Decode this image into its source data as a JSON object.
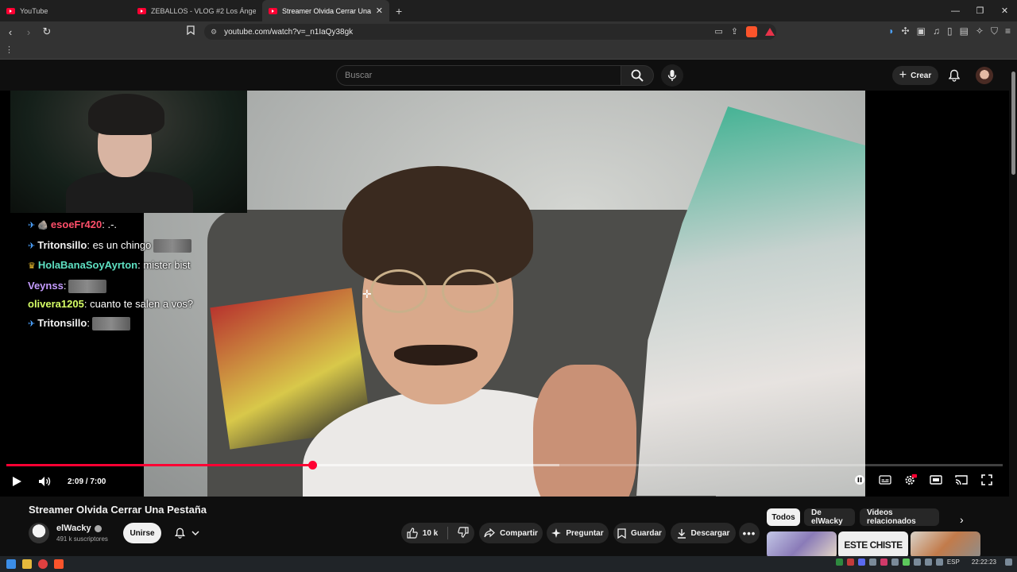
{
  "browser": {
    "tabs": [
      {
        "title": "YouTube",
        "active": false
      },
      {
        "title": "ZEBALLOS - VLOG #2 Los Ángeles | A",
        "active": false
      },
      {
        "title": "Streamer Olvida Cerrar Una Pestañ",
        "active": true
      }
    ],
    "url": "youtube.com/watch?v=_n1IaQy38gk",
    "window_controls": [
      "—",
      "❐",
      "✕"
    ]
  },
  "youtube": {
    "search_placeholder": "Buscar",
    "create_label": "Crear"
  },
  "chat": [
    {
      "badge": "✈",
      "badge2": "🪨",
      "user": "esoeFr420",
      "user_color": "#ff4f6a",
      "message": ": .-."
    },
    {
      "badge": "✈",
      "user": "Tritonsillo",
      "user_color": "#f1f1f1",
      "message": ": es un chingo",
      "emote": true
    },
    {
      "badge": "♛",
      "user": "HolaBanaSoyAyrton",
      "user_color": "#5ee0c2",
      "message": ": mister bist"
    },
    {
      "user": "Veynss",
      "user_color": "#c59cff",
      "message": ":",
      "emote": true
    },
    {
      "user": "olivera1205",
      "user_color": "#d6ff66",
      "message": ": cuanto te salen a vos?"
    },
    {
      "badge": "✈",
      "user": "Tritonsillo",
      "user_color": "#f1f1f1",
      "message": ":",
      "emote": true
    }
  ],
  "player": {
    "current_time": "2:09",
    "duration": "7:00",
    "time_display": "2:09 / 7:00",
    "played_fraction": 0.307,
    "loaded_fraction": 0.555,
    "accent": "#ff0033"
  },
  "video": {
    "title": "Streamer Olvida Cerrar Una Pestaña",
    "channel": "elWacky",
    "subscribers": "491 k suscriptores",
    "join_label": "Unirse",
    "likes": "10 k",
    "share_label": "Compartir",
    "ask_label": "Preguntar",
    "save_label": "Guardar",
    "download_label": "Descargar"
  },
  "chips": [
    {
      "label": "Todos",
      "selected": true
    },
    {
      "label": "De elWacky",
      "selected": false
    },
    {
      "label": "Videos relacionados",
      "selected": false
    }
  ],
  "related": [
    {
      "thumb_text": ""
    },
    {
      "thumb_text": "ESTE CHISTE"
    },
    {
      "thumb_text": ""
    }
  ],
  "taskbar": {
    "lang": "ESP",
    "clock": "22:22:23"
  }
}
